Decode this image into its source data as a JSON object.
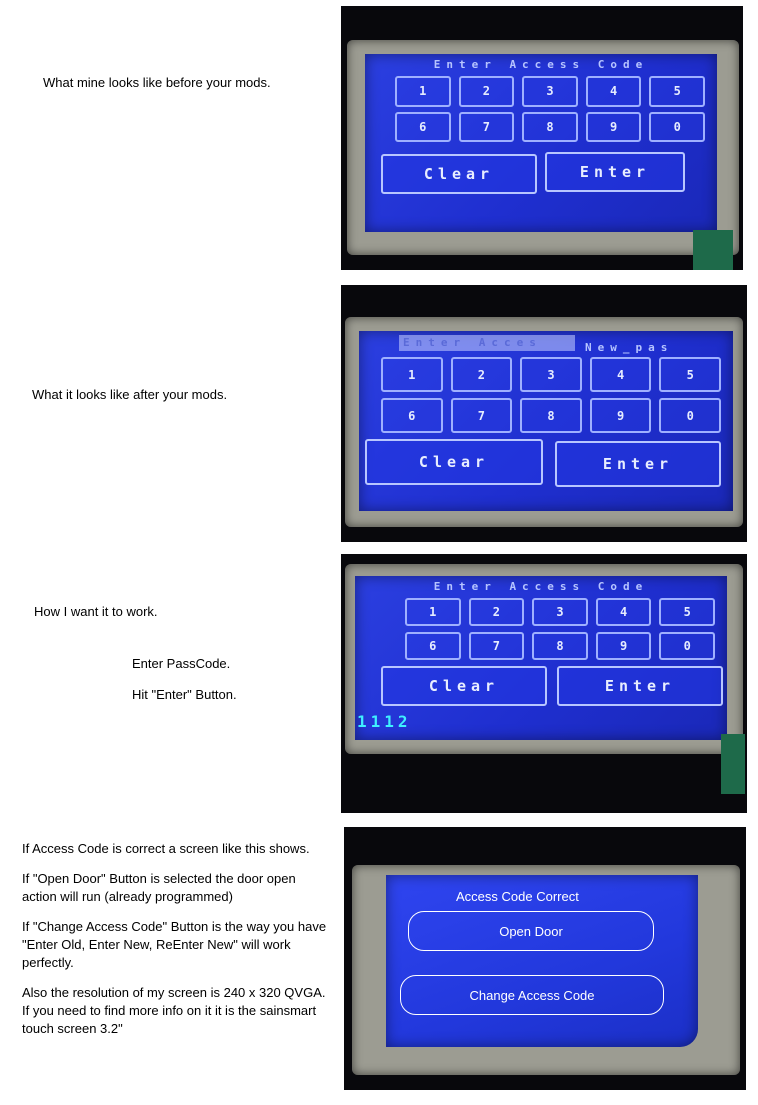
{
  "notes": {
    "before": "What mine looks like before your mods.",
    "after": "What it looks like after your mods.",
    "want": "How I want it to work.",
    "step1": "Enter PassCode.",
    "step2": "Hit \"Enter\" Button.",
    "p1": "If Access Code is correct a screen like this shows.",
    "p2": "If \"Open Door\" Button is selected the door open action will run (already programmed)",
    "p3": "If \"Change Access Code\" Button is the way you have \"Enter Old, Enter New, ReEnter New\" will work perfectly.",
    "p4": "Also the resolution of my screen is 240 x 320 QVGA. If you need to find more info on it it is the sainsmart touch screen 3.2\""
  },
  "keypad": {
    "title": "Enter Access Code",
    "title_overlap_left": "Enter Acces",
    "title_overlap_right": "New_pas",
    "keys": [
      "1",
      "2",
      "3",
      "4",
      "5",
      "6",
      "7",
      "8",
      "9",
      "0"
    ],
    "clear": "Clear",
    "enter": "Enter",
    "entered_code": "1112"
  },
  "success_screen": {
    "title": "Access Code Correct",
    "open_door": "Open Door",
    "change_code": "Change Access Code"
  },
  "colors": {
    "screen_blue": "#2b3fe0",
    "code_cyan": "#3ff0ff"
  }
}
